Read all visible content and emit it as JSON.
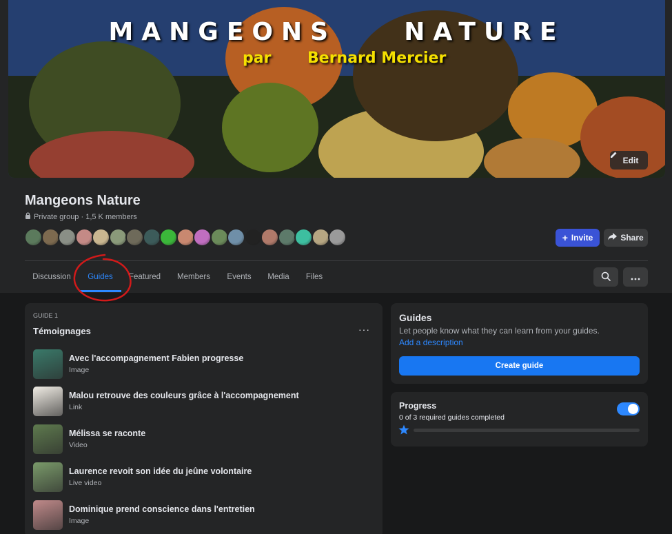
{
  "cover": {
    "title": "MANGEONS    NATURE",
    "sub_par": "par",
    "sub_author": "Bernard Mercier",
    "edit_label": "Edit"
  },
  "group": {
    "name": "Mangeons Nature",
    "meta": "Private group · 1,5 K members",
    "member_avatar_colors": [
      "#5b7a5c",
      "#7d6a4f",
      "#8a8f86",
      "#c48a86",
      "#c9b690",
      "#8a9a7a",
      "#6e6a5a",
      "#3c5b5a",
      "#3bb73a",
      "#c98870",
      "#c06ec0",
      "#6b8b5a",
      "#6f8fa8",
      "#222222",
      "#b07a6a",
      "#5d7a6a",
      "#3dbfa0",
      "#b6a682",
      "#9a9a9a"
    ]
  },
  "actions": {
    "invite_label": "Invite",
    "share_label": "Share"
  },
  "tabs": [
    {
      "label": "Discussion"
    },
    {
      "label": "Guides"
    },
    {
      "label": "Featured"
    },
    {
      "label": "Members"
    },
    {
      "label": "Events"
    },
    {
      "label": "Media"
    },
    {
      "label": "Files"
    }
  ],
  "guide": {
    "number": "GUIDE 1",
    "title": "Témoignages",
    "more": "···",
    "items": [
      {
        "title": "Avec l'accompagnement Fabien progresse",
        "type": "Image",
        "thumb_color": "#3a7a6a"
      },
      {
        "title": "Malou retrouve des couleurs grâce à l'accompagnement",
        "type": "Link",
        "thumb_color": "#f0ece4"
      },
      {
        "title": "Mélissa se raconte",
        "type": "Video",
        "thumb_color": "#5e7a4e"
      },
      {
        "title": "Laurence revoit son idée du jeûne volontaire",
        "type": "Live video",
        "thumb_color": "#7a9a6a"
      },
      {
        "title": "Dominique prend conscience dans l'entretien",
        "type": "Image",
        "thumb_color": "#c08a8a"
      }
    ]
  },
  "guides_panel": {
    "title": "Guides",
    "description": "Let people know what they can learn from your guides.",
    "link": "Add a description",
    "button": "Create guide"
  },
  "progress": {
    "title": "Progress",
    "text": "0 of 3 required guides completed",
    "completed_fraction": 0,
    "toggle_on": true
  }
}
